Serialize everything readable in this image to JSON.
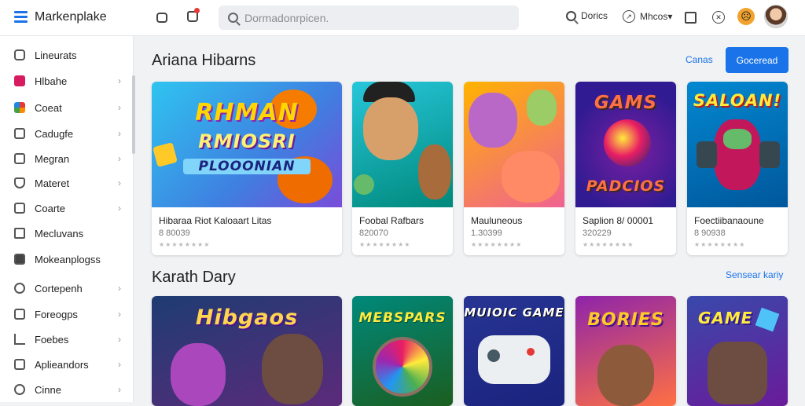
{
  "header": {
    "app_title": "Markenplake",
    "search_placeholder": "Dormadonrpicen.",
    "items": [
      {
        "label": "Dorics"
      },
      {
        "label": "Mhcos▾"
      }
    ]
  },
  "sidebar": {
    "items": [
      {
        "label": "Lineurats",
        "chevron": false
      },
      {
        "label": "Hlbahe",
        "chevron": true
      },
      {
        "label": "Coeat",
        "chevron": true
      },
      {
        "label": "Cadugfe",
        "chevron": true
      },
      {
        "label": "Megran",
        "chevron": true
      },
      {
        "label": "Materet",
        "chevron": true
      },
      {
        "label": "Coarte",
        "chevron": true
      },
      {
        "label": "Mecluvans",
        "chevron": false
      },
      {
        "label": "Mokeanplogss",
        "chevron": true
      },
      {
        "label": "Cortepenh",
        "chevron": true
      },
      {
        "label": "Foreogps",
        "chevron": true
      },
      {
        "label": "Foebes",
        "chevron": true
      },
      {
        "label": "Aplieandors",
        "chevron": true
      },
      {
        "label": "Cinne",
        "chevron": true
      }
    ]
  },
  "section1": {
    "title": "Ariana Hibarns",
    "link_label": "Canas",
    "button_label": "Goceread",
    "cards": [
      {
        "art_title": "RHMAN",
        "art_sub": "RMIOSRI",
        "art_banner": "PLOOONIAN",
        "name": "Hibaraa  Riot Kaloaart Litas",
        "price": "8 80039",
        "stars": "★★★★★★★★"
      },
      {
        "art_title": "",
        "name": "Foobal Rafbars",
        "price": "820070",
        "stars": "★★★★★★★★"
      },
      {
        "art_title": "",
        "name": "Mauluneous",
        "price": "1.30399",
        "stars": "★★★★★★★★"
      },
      {
        "art_title": "GAMS",
        "art_banner": "PADCIOS",
        "name": "Saplion  8/ 00001",
        "price": "320229",
        "stars": "★★★★★★★★"
      },
      {
        "art_title": "SALOAN!",
        "name": "Foectiibanaoune",
        "price": "8 90938",
        "stars": "★★★★★★★★"
      }
    ]
  },
  "section2": {
    "title": "Karath Dary",
    "link_label": "Sensear kariy",
    "cards": [
      {
        "art_title": "Hibgaos"
      },
      {
        "art_title": "MEBSPARS"
      },
      {
        "art_title": "MUIOIC GAME"
      },
      {
        "art_title": "BORIES"
      },
      {
        "art_title": "GAME"
      }
    ]
  },
  "colors": {
    "accent": "#1a73e8"
  }
}
